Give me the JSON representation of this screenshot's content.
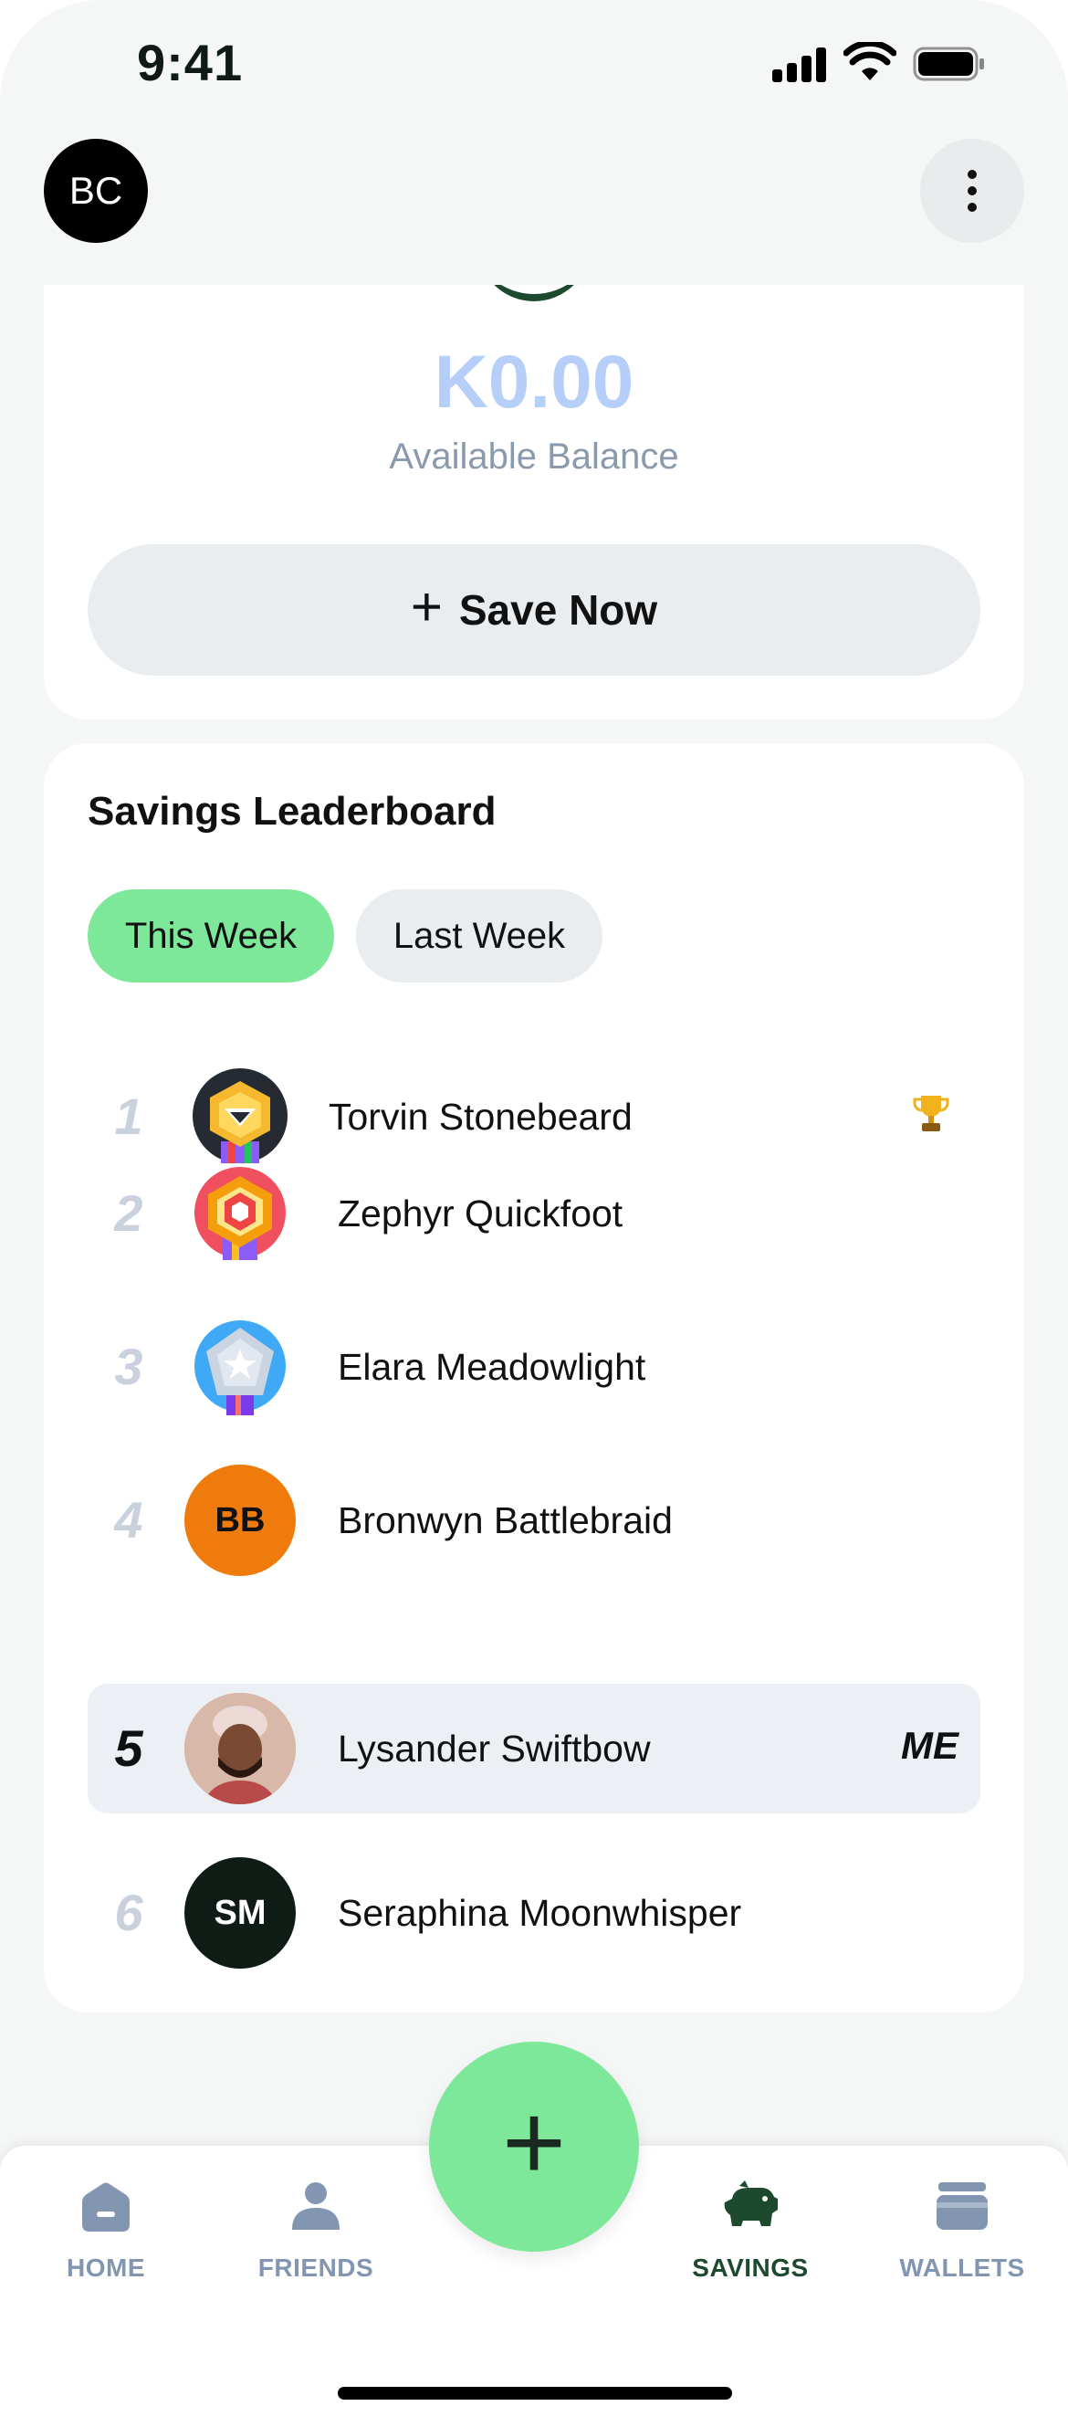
{
  "status_bar": {
    "time": "9:41"
  },
  "header": {
    "avatar_initials": "BC"
  },
  "balance": {
    "amount": "K0.00",
    "label": "Available Balance",
    "save_label": "Save Now"
  },
  "leaderboard": {
    "title": "Savings Leaderboard",
    "tabs": [
      {
        "label": "This Week",
        "active": true
      },
      {
        "label": "Last Week",
        "active": false
      }
    ],
    "rows": [
      {
        "rank": "1",
        "name": "Torvin Stonebeard",
        "avatar": "gold-badge",
        "trophy": true
      },
      {
        "rank": "2",
        "name": "Zephyr Quickfoot",
        "avatar": "red-badge"
      },
      {
        "rank": "3",
        "name": "Elara Meadowlight",
        "avatar": "blue-badge"
      },
      {
        "rank": "4",
        "name": "Bronwyn Battlebraid",
        "avatar_initials": "BB",
        "avatar_color": "#f07b0d"
      },
      {
        "rank": "5",
        "name": "Lysander Swiftbow",
        "avatar": "photo",
        "tag": "ME",
        "current_user": true
      },
      {
        "rank": "6",
        "name": "Seraphina Moonwhisper",
        "avatar_initials": "SM",
        "avatar_color": "#0f1c16"
      }
    ]
  },
  "nav": {
    "items": [
      {
        "label": "HOME",
        "icon": "home-icon"
      },
      {
        "label": "FRIENDS",
        "icon": "friends-icon"
      },
      {
        "label": "SAVINGS",
        "icon": "piggy-bank-icon",
        "active": true
      },
      {
        "label": "WALLETS",
        "icon": "wallet-icon"
      }
    ],
    "fab_icon": "plus-icon"
  },
  "colors": {
    "accent_green": "#7ee89a",
    "dark_green": "#1d4a2e",
    "muted_blue": "#8295b1",
    "balance_blue": "#b6cff8"
  }
}
